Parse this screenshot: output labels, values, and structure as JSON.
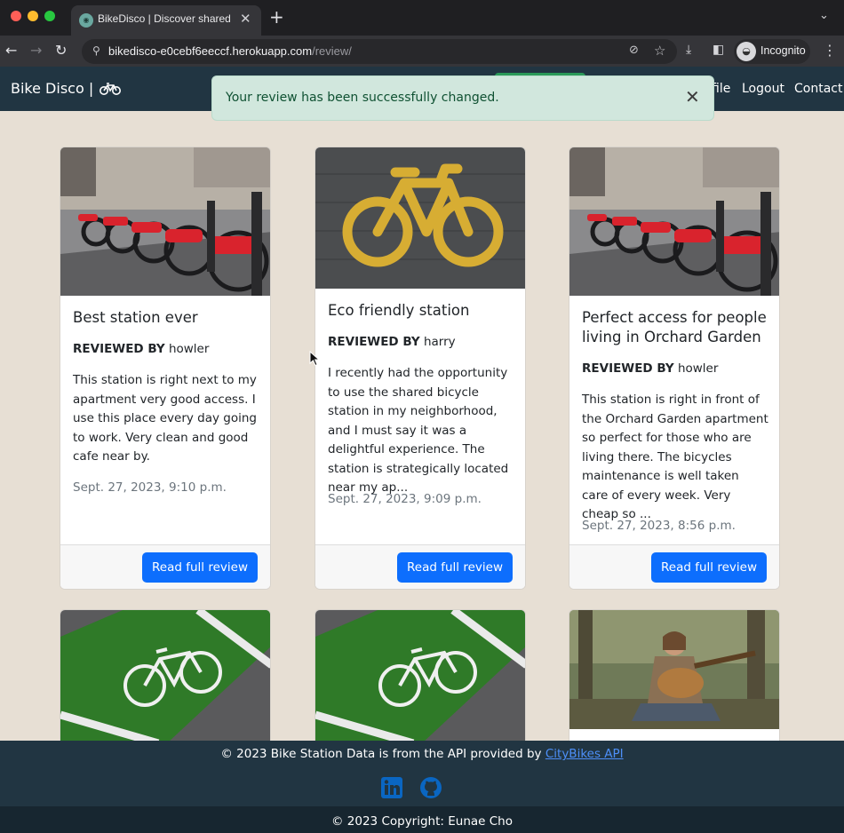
{
  "browser": {
    "tab_title": "BikeDisco | Discover shared bi",
    "tab_close": "✕",
    "new_tab": "+",
    "url_host": "bikedisco-e0cebf6eeccf.herokuapp.com",
    "url_path": "/review/",
    "incognito_label": "Incognito"
  },
  "site": {
    "brand": "Bike Disco |",
    "nav": {
      "profile_fragment": "file",
      "logout": "Logout",
      "contact": "Contact"
    }
  },
  "alert": {
    "message": "Your review has been successfully changed.",
    "close": "✕"
  },
  "reviews": [
    {
      "title": "Best station ever",
      "reviewed_by_label": "REVIEWED BY",
      "reviewer": "howler",
      "excerpt": "This station is right next to my apartment very good access. I use this place every day going to work. Very clean and good cafe near by.",
      "date": "Sept. 27, 2023, 9:10 p.m.",
      "button": "Read full review",
      "image": "bike-dock-row"
    },
    {
      "title": "Eco friendly station",
      "reviewed_by_label": "REVIEWED BY",
      "reviewer": "harry",
      "excerpt": "I recently had the opportunity to use the shared bicycle station in my neighborhood, and I must say it was a delightful experience. The station is strategically located near my ap...",
      "date": "Sept. 27, 2023, 9:09 p.m.",
      "button": "Read full review",
      "image": "yellow-bike-lane-symbol"
    },
    {
      "title": "Perfect access for people living in Orchard Garden",
      "reviewed_by_label": "REVIEWED BY",
      "reviewer": "howler",
      "excerpt": "This station is right in front of the Orchard Garden apartment so perfect for those who are living there. The bicycles maintenance is well taken care of every week. Very cheap so ...",
      "date": "Sept. 27, 2023, 8:56 p.m.",
      "button": "Read full review",
      "image": "bike-dock-row"
    }
  ],
  "lower_cards": [
    {
      "image": "green-bike-lane"
    },
    {
      "image": "green-bike-lane"
    },
    {
      "image": "guitar-player-forest"
    }
  ],
  "footer": {
    "credit_prefix": "© 2023 Bike Station Data is from the API provided by",
    "credit_link": "CityBikes API",
    "copyright": "© 2023 Copyright: Eunae Cho"
  },
  "colors": {
    "page_bg": "#e7dfd4",
    "navbar": "#213542",
    "primary_button": "#0d6efd",
    "alert_bg": "#d1e7dd",
    "alert_text": "#0f5132"
  }
}
